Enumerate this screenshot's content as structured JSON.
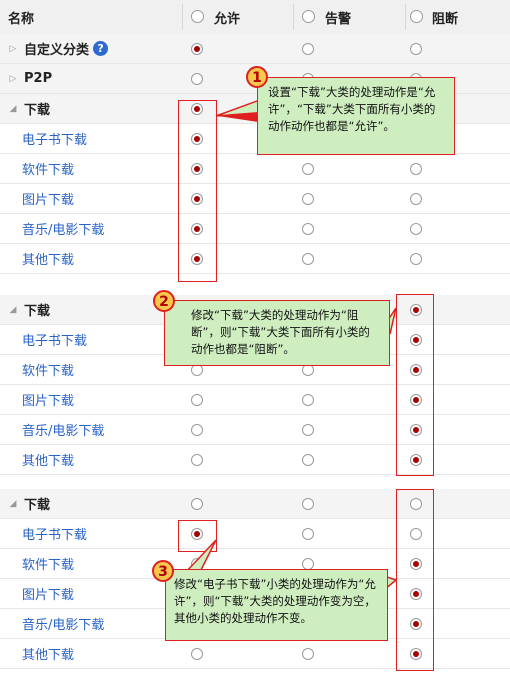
{
  "header": {
    "name_col": "名称",
    "allow": "允许",
    "alert": "告警",
    "block": "阻断"
  },
  "panel1": {
    "rows": [
      {
        "label": "自定义分类",
        "kind": "cat",
        "collapsed": true,
        "help": "?",
        "state": "allow"
      },
      {
        "label": "P2P",
        "kind": "cat",
        "collapsed": true,
        "state": "none"
      },
      {
        "label": "下载",
        "kind": "cat",
        "collapsed": false,
        "state": "allow"
      },
      {
        "label": "电子书下载",
        "kind": "sub",
        "state": "allow"
      },
      {
        "label": "软件下载",
        "kind": "sub",
        "state": "allow"
      },
      {
        "label": "图片下载",
        "kind": "sub",
        "state": "allow"
      },
      {
        "label": "音乐/电影下载",
        "kind": "sub",
        "state": "allow"
      },
      {
        "label": "其他下载",
        "kind": "sub",
        "state": "allow"
      }
    ]
  },
  "panel2": {
    "rows": [
      {
        "label": "下载",
        "kind": "cat",
        "collapsed": false,
        "state": "block"
      },
      {
        "label": "电子书下载",
        "kind": "sub",
        "state": "block"
      },
      {
        "label": "软件下载",
        "kind": "sub",
        "state": "block"
      },
      {
        "label": "图片下载",
        "kind": "sub",
        "state": "block"
      },
      {
        "label": "音乐/电影下载",
        "kind": "sub",
        "state": "block"
      },
      {
        "label": "其他下载",
        "kind": "sub",
        "state": "block"
      }
    ]
  },
  "panel3": {
    "rows": [
      {
        "label": "下载",
        "kind": "cat",
        "collapsed": false,
        "state": "none"
      },
      {
        "label": "电子书下载",
        "kind": "sub",
        "state": "allow"
      },
      {
        "label": "软件下载",
        "kind": "sub",
        "state": "block"
      },
      {
        "label": "图片下载",
        "kind": "sub",
        "state": "block"
      },
      {
        "label": "音乐/电影下载",
        "kind": "sub",
        "state": "block"
      },
      {
        "label": "其他下载",
        "kind": "sub",
        "state": "block"
      }
    ]
  },
  "callouts": {
    "c1": {
      "num": "1",
      "text": "设置“下载”大类的处理动作是“允许”，“下载”大类下面所有小类的动作动作也都是“允许”。"
    },
    "c2": {
      "num": "2",
      "text": "修改“下载”大类的处理动作为“阻断”，则“下载”大类下面所有小类的动作也都是“阻断”。"
    },
    "c3": {
      "num": "3",
      "text": "修改“电子书下载”小类的处理动作为“允许”，则“下载”大类的处理动作变为空，其他小类的处理动作不变。"
    }
  },
  "colors": {
    "selected_dot": "#a80000",
    "link_text": "#2a63c8",
    "highlight_border": "#e02020",
    "callout_bg": "#cfeec0",
    "badge_bg": "#f7c84a"
  }
}
